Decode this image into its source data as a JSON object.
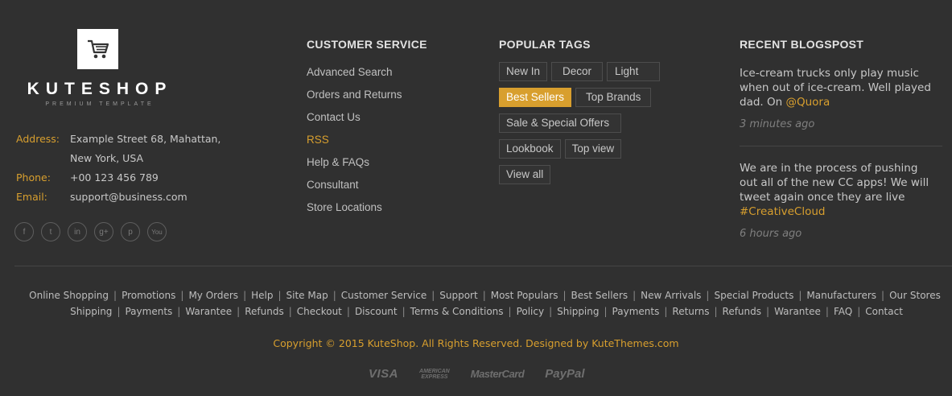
{
  "brand": {
    "name": "KUTESHOP",
    "tagline": "PREMIUM TEMPLATE",
    "logo_icon": "cart-icon"
  },
  "contact": {
    "address_label": "Address:",
    "address_line1": "Example Street 68, Mahattan,",
    "address_line2": "New York, USA",
    "phone_label": "Phone:",
    "phone": "+00 123 456 789",
    "email_label": "Email:",
    "email": "support@business.com"
  },
  "socials": [
    {
      "icon": "facebook-icon",
      "glyph": "f"
    },
    {
      "icon": "twitter-icon",
      "glyph": "t"
    },
    {
      "icon": "linkedin-icon",
      "glyph": "in"
    },
    {
      "icon": "google-plus-icon",
      "glyph": "g+"
    },
    {
      "icon": "pinterest-icon",
      "glyph": "p"
    },
    {
      "icon": "youtube-icon",
      "glyph": "You"
    }
  ],
  "customer_service": {
    "title": "CUSTOMER SERVICE",
    "items": [
      "Advanced Search",
      "Orders and Returns",
      "Contact Us",
      "RSS",
      "Help & FAQs",
      "Consultant",
      "Store Locations"
    ],
    "highlighted": "RSS"
  },
  "popular_tags": {
    "title": "POPULAR TAGS",
    "rows": [
      [
        "New In",
        "Decor",
        "Light"
      ],
      [
        "Best Sellers",
        "Top Brands"
      ],
      [
        "Sale & Special Offers"
      ],
      [
        "Lookbook",
        "Top view"
      ],
      [
        "View all"
      ]
    ],
    "active": "Best Sellers"
  },
  "recent_blog": {
    "title": "RECENT BLOGSPOST",
    "posts": [
      {
        "text_line1": "Ice-cream trucks only play music",
        "text_line2": "when out of ice-cream. Well played",
        "text_line3": "dad. On ",
        "link": "@Quora",
        "time": "3 minutes ago"
      },
      {
        "text_line1": "We are in the process of pushing",
        "text_line2": "out all of the new CC apps! We will",
        "text_line3": "tweet again once they are live",
        "link": "#CreativeCloud",
        "time": "6 hours ago"
      }
    ]
  },
  "footer_links_row1": [
    "Online Shopping",
    "Promotions",
    "My Orders",
    "Help",
    "Site Map",
    "Customer Service",
    "Support",
    "Most Populars",
    "Best Sellers",
    "New Arrivals",
    "Special Products",
    "Manufacturers",
    "Our Stores"
  ],
  "footer_links_row2": [
    "Shipping",
    "Payments",
    "Warantee",
    "Refunds",
    "Checkout",
    "Discount",
    "Terms & Conditions",
    "Policy",
    "Shipping",
    "Payments",
    "Returns",
    "Refunds",
    "Warantee",
    "FAQ",
    "Contact"
  ],
  "link_separator": "|",
  "copyright": "Copyright © 2015 KuteShop. All Rights Reserved. Designed by KuteThemes.com",
  "payments": {
    "visa": "VISA",
    "amex_line1": "AMERICAN",
    "amex_line2": "EXPRESS",
    "mastercard": "MasterCard",
    "paypal": "PayPal"
  },
  "colors": {
    "background": "#303030",
    "accent": "#d89f2e"
  }
}
